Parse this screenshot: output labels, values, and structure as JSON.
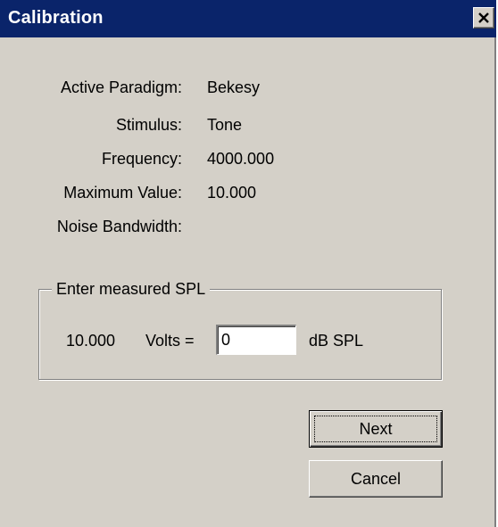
{
  "window": {
    "title": "Calibration"
  },
  "info": {
    "active_paradigm_label": "Active Paradigm:",
    "active_paradigm_value": "Bekesy",
    "stimulus_label": "Stimulus:",
    "stimulus_value": "Tone",
    "frequency_label": "Frequency:",
    "frequency_value": "4000.000",
    "max_value_label": "Maximum Value:",
    "max_value_value": "10.000",
    "noise_bandwidth_label": "Noise Bandwidth:",
    "noise_bandwidth_value": ""
  },
  "spl_group": {
    "title": "Enter measured SPL",
    "volts_value": "10.000",
    "volts_label": "Volts =",
    "spl_input_value": "0",
    "unit_label": "dB SPL"
  },
  "buttons": {
    "next_label": "Next",
    "cancel_label": "Cancel"
  },
  "icons": {
    "close": "close-icon"
  },
  "colors": {
    "titlebar": "#0a246a",
    "face": "#d4d0c8"
  }
}
